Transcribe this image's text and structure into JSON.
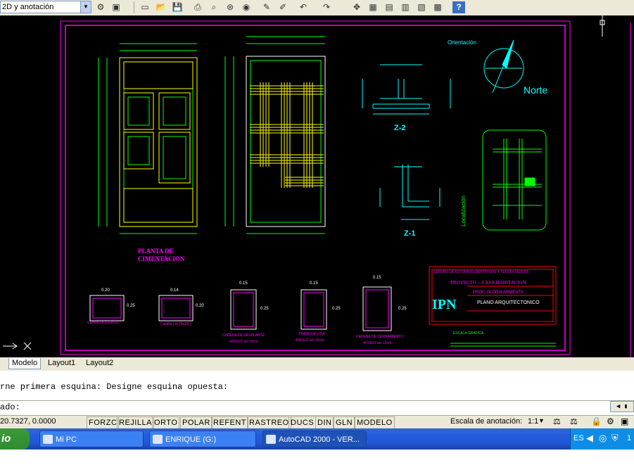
{
  "toolbar": {
    "workspace_combo": "2D y anotación",
    "icons": [
      "new-icon",
      "open-icon",
      "save-icon",
      "print-icon",
      "preview-icon",
      "publish-icon",
      "cut-icon",
      "matchprop-icon",
      "undo-icon",
      "redo-icon",
      "pan-icon",
      "zoom-icon",
      "properties-icon",
      "designcenter-icon",
      "toolpalette-icon",
      "sheetset-icon",
      "calc-icon",
      "help-icon"
    ]
  },
  "drawing": {
    "orientation_label": "Orientación",
    "north_label": "Norte",
    "foundation_title_line1": "PLANTA DE",
    "foundation_title_line2": "CIMENTACION",
    "detail_z2": "Z-2",
    "detail_z1": "Z-1",
    "location_label": "Localización",
    "title_block": {
      "school": "CENTRO DE ESTUDIOS CIENTIFICOS Y TECNOLOGICOS",
      "project": "PROYECTO :- CASA HABITACION",
      "logo": "IPN",
      "professor": "PROF. GLORIA ARMENTA",
      "sheet": "PLANO ARQUITECTONICO",
      "graphic_scale": "ESCALA GRAFICA"
    },
    "sections": [
      {
        "top": "0.20",
        "side": "0.25",
        "caption": "Castillo ( K1(15x20) )"
      },
      {
        "top": "0.14",
        "side": "0.20",
        "caption": "Castillo ( K(15x15) )"
      },
      {
        "top": "0.15",
        "side": "0.25",
        "caption": "CADENA DE DESPLANTE",
        "sub": "4#3 E#2 a/c 15cm."
      },
      {
        "top": "0.15",
        "side": "0.25",
        "caption": "TRABE DE LIGA",
        "sub": "4#3 E#2 a/c 15cm."
      },
      {
        "top": "0.15",
        "side": "0.25",
        "caption": "CADENA DE CERRAMIENTO",
        "sub": "4#3 E#2 a/c 15cm."
      }
    ]
  },
  "tabs": {
    "model": "Modelo",
    "layout1": "Layout1",
    "layout2": "Layout2"
  },
  "command": {
    "history": "rne primera esquina: Designe esquina opuesta:",
    "prompt": "ado:"
  },
  "status": {
    "coordinates": "20.7327, 0.0000",
    "toggles": [
      "FORZC",
      "REJILLA",
      "ORTO",
      "POLAR",
      "REFENT",
      "RASTREO",
      "DUCS",
      "DIN",
      "GLN",
      "MODELO"
    ],
    "annotation_scale_label": "Escala de anotación:",
    "annotation_scale_value": "1:1"
  },
  "taskbar": {
    "start_label": "io",
    "tasks": [
      "Mi PC",
      "ENRIQUE (G:)",
      "AutoCAD 2000 - VER..."
    ],
    "tray_lang": "ES",
    "tray_time": "1"
  }
}
